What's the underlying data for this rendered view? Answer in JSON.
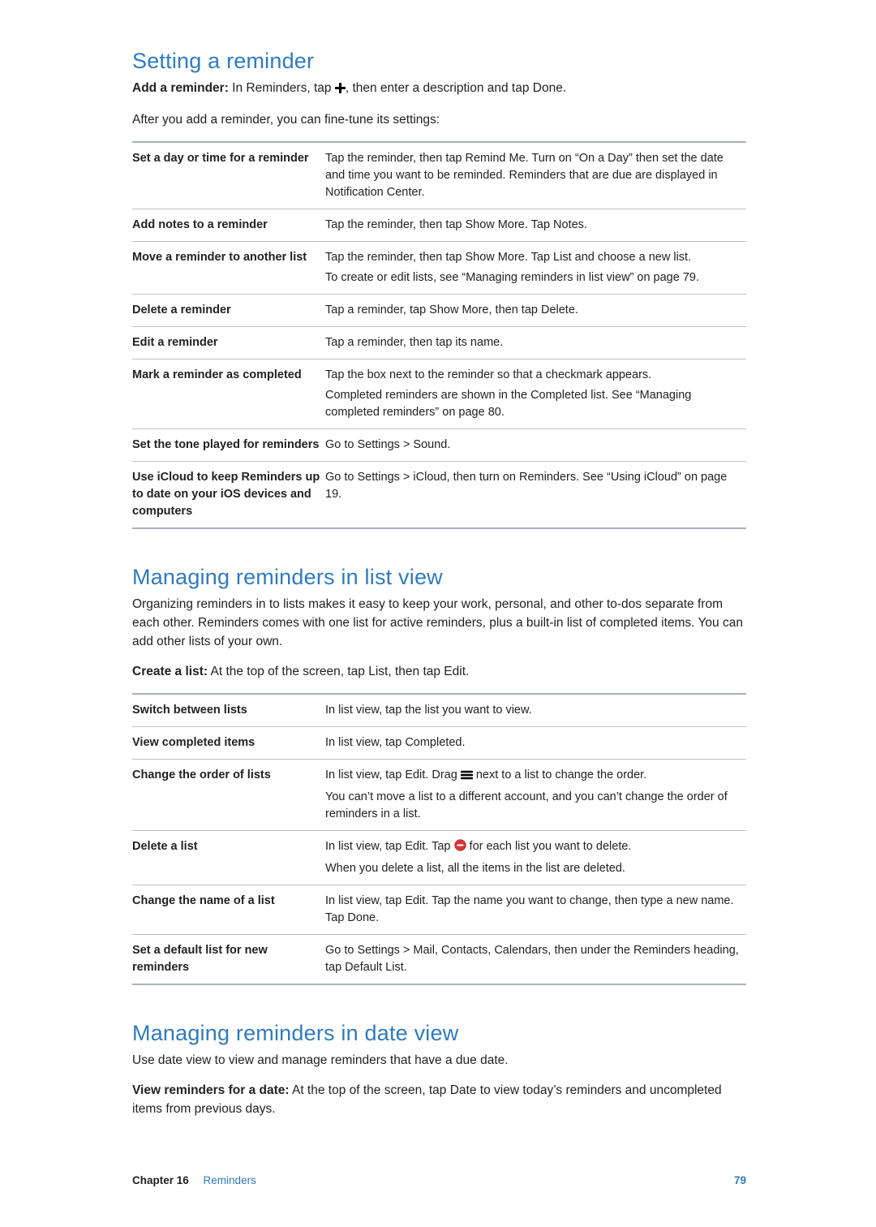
{
  "section1": {
    "heading": "Setting a reminder",
    "intro_bold": "Add a reminder:",
    "intro_rest_before": "In Reminders, tap",
    "intro_rest_after": ", then enter a description and tap Done.",
    "after": "After you add a reminder, you can fine-tune its settings:",
    "rows": [
      {
        "l": "Set a day or time for a reminder",
        "r": [
          "Tap the reminder, then tap Remind Me. Turn on “On a Day” then set the date and time you want to be reminded. Reminders that are due are displayed in Notification Center."
        ]
      },
      {
        "l": "Add notes to a reminder",
        "r": [
          "Tap the reminder, then tap Show More. Tap Notes."
        ]
      },
      {
        "l": "Move a reminder to another list",
        "r": [
          "Tap the reminder, then tap Show More. Tap List and choose a new list.",
          "To create or edit lists, see “Managing reminders in list view” on page 79."
        ]
      },
      {
        "l": "Delete a reminder",
        "r": [
          "Tap a reminder, tap Show More, then tap Delete."
        ]
      },
      {
        "l": "Edit a reminder",
        "r": [
          "Tap a reminder, then tap its name."
        ]
      },
      {
        "l": "Mark a reminder as completed",
        "r": [
          "Tap the box next to the reminder so that a checkmark appears.",
          "Completed reminders are shown in the Completed list. See “Managing completed reminders” on page 80."
        ]
      },
      {
        "l": "Set the tone played for reminders",
        "r": [
          "Go to Settings > Sound."
        ]
      },
      {
        "l": "Use iCloud to keep Reminders up to date on your iOS devices and computers",
        "r": [
          "Go to Settings > iCloud, then turn on Reminders. See “Using iCloud” on page 19."
        ]
      }
    ]
  },
  "section2": {
    "heading": "Managing reminders in list view",
    "intro": "Organizing reminders in to lists makes it easy to keep your work, personal, and other to-dos separate from each other. Reminders comes with one list for active reminders, plus a built-in list of completed items. You can add other lists of your own.",
    "create_bold": "Create a list:",
    "create_rest": "At the top of the screen, tap List, then tap Edit.",
    "rows": [
      {
        "l": "Switch between lists",
        "r": [
          {
            "t": "In list view, tap the list you want to view."
          }
        ]
      },
      {
        "l": "View completed items",
        "r": [
          {
            "t": "In list view, tap Completed."
          }
        ]
      },
      {
        "l": "Change the order of lists",
        "r": [
          {
            "pre": "In list view, tap Edit. Drag ",
            "icon": "drag",
            "post": " next to a list to change the order."
          },
          {
            "t": "You can’t move a list to a different account, and you can’t change the order of reminders in a list."
          }
        ]
      },
      {
        "l": "Delete a list",
        "r": [
          {
            "pre": "In list view, tap Edit. Tap ",
            "icon": "delete",
            "post": " for each list you want to delete."
          },
          {
            "t": "When you delete a list, all the items in the list are deleted."
          }
        ]
      },
      {
        "l": "Change the name of a list",
        "r": [
          {
            "t": "In list view, tap Edit. Tap the name you want to change, then type a new name. Tap Done."
          }
        ]
      },
      {
        "l": "Set a default list for new reminders",
        "r": [
          {
            "t": "Go to Settings > Mail, Contacts, Calendars, then under the Reminders heading, tap Default List."
          }
        ]
      }
    ]
  },
  "section3": {
    "heading": "Managing reminders in date view",
    "intro": "Use date view to view and manage reminders that have a due date.",
    "view_bold": "View reminders for a date:",
    "view_rest": "At the top of the screen, tap Date to view today’s reminders and uncompleted items from previous days."
  },
  "footer": {
    "chapter_label": "Chapter 16",
    "chapter_title": "Reminders",
    "page": "79"
  },
  "icons": {
    "plus": "plus-icon",
    "drag": "drag-handle-icon",
    "delete": "delete-minus-icon"
  }
}
